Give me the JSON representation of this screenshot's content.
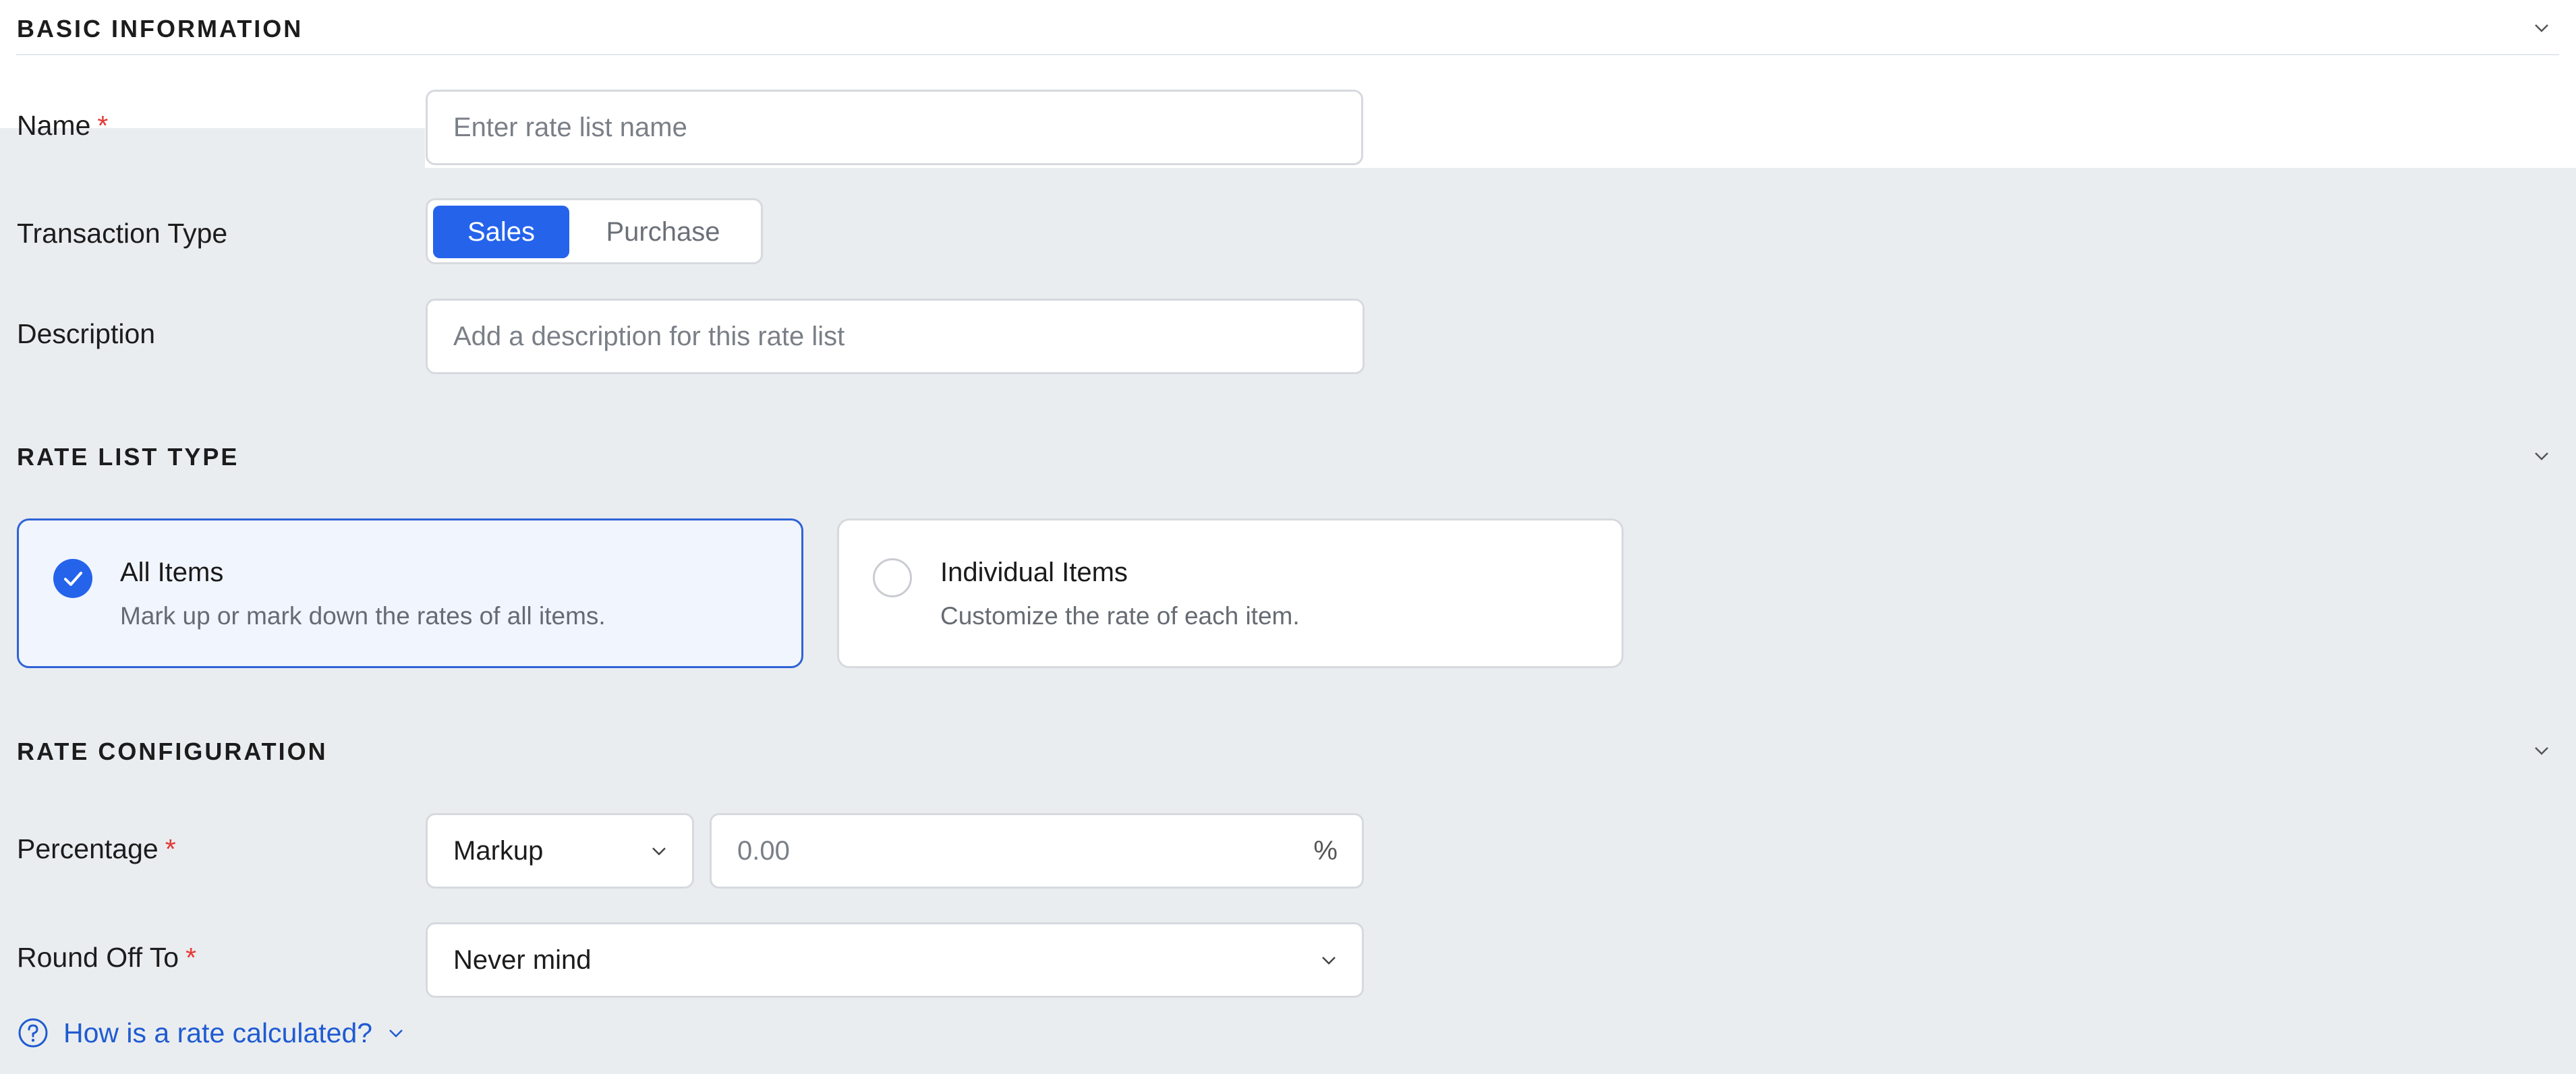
{
  "sections": {
    "basic_info": "BASIC INFORMATION",
    "rate_list_type": "RATE LIST TYPE",
    "rate_configuration": "RATE CONFIGURATION"
  },
  "basic": {
    "name_label": "Name",
    "name_placeholder": "Enter rate list name",
    "transaction_type_label": "Transaction Type",
    "transaction_options": [
      "Sales",
      "Purchase"
    ],
    "transaction_selected": "Sales",
    "description_label": "Description",
    "description_placeholder": "Add a description for this rate list"
  },
  "rate_list_type": {
    "selected": "All Items",
    "options": [
      {
        "title": "All Items",
        "description": "Mark up or mark down the rates of all items."
      },
      {
        "title": "Individual Items",
        "description": "Customize the rate of each item."
      }
    ]
  },
  "rate_config": {
    "percentage_label": "Percentage",
    "percentage_type": "Markup",
    "percentage_placeholder": "0.00",
    "percentage_suffix": "%",
    "round_off_label": "Round Off To",
    "round_off_value": "Never mind",
    "help_link": "How is a rate calculated?"
  },
  "required_marker": "*",
  "colors": {
    "accent": "#2563eb",
    "required": "#e53935",
    "link": "#1f5bd1",
    "background": "#eaedf0"
  },
  "icons": [
    "chevron-down-icon",
    "check-icon",
    "help-circle-icon"
  ]
}
